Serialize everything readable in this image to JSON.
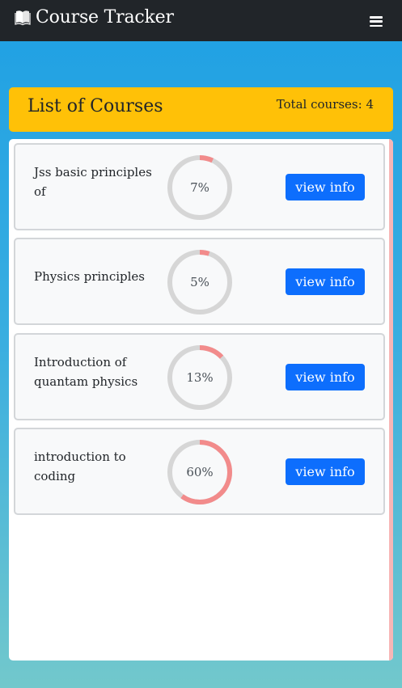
{
  "navbar": {
    "title": "Course Tracker",
    "brand_icon": "book-icon",
    "menu_icon": "hamburger-menu-icon"
  },
  "header": {
    "title": "List of Courses",
    "total": "Total courses: 4"
  },
  "colors": {
    "navbar": "#212529",
    "header": "#ffc107",
    "button": "#0d6efd",
    "progress": "#f28b8b",
    "track": "#d6d6d6"
  },
  "courses": [
    {
      "name": "Jss basic principles of",
      "progress": 7,
      "progress_label": "7%",
      "button": "view info"
    },
    {
      "name": "Physics principles",
      "progress": 5,
      "progress_label": "5%",
      "button": "view info"
    },
    {
      "name": "Introduction of quantam physics",
      "progress": 13,
      "progress_label": "13%",
      "button": "view info"
    },
    {
      "name": "introduction to coding",
      "progress": 60,
      "progress_label": "60%",
      "button": "view info"
    }
  ]
}
